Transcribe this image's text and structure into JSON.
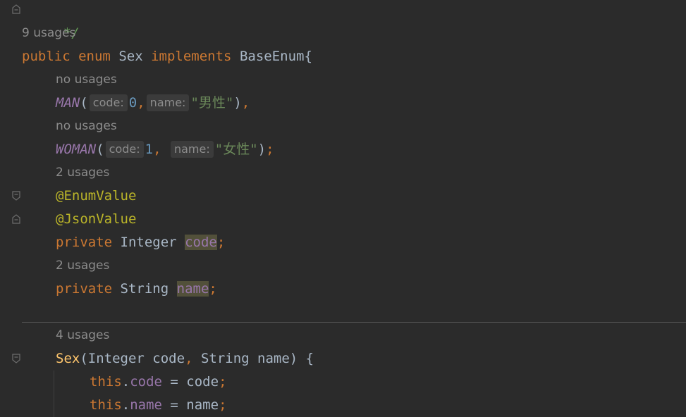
{
  "code": {
    "comment_end": "*/",
    "usages": {
      "enum_decl": "9 usages",
      "man": "no usages",
      "woman": "no usages",
      "code_field": "2 usages",
      "name_field": "2 usages",
      "constructor": "4 usages"
    },
    "enum_decl": {
      "kw_public": "public",
      "kw_enum": "enum",
      "name": "Sex",
      "kw_implements": "implements",
      "iface": "BaseEnum",
      "brace": "{"
    },
    "man": {
      "name": "MAN",
      "open": "(",
      "hint_code": "code:",
      "code_val": "0",
      "comma": ",",
      "hint_name": "name:",
      "name_val": "\"男性\"",
      "close": ")",
      "end": ","
    },
    "woman": {
      "name": "WOMAN",
      "open": "(",
      "hint_code": "code:",
      "code_val": "1",
      "comma": ", ",
      "hint_name": "name:",
      "name_val": "\"女性\"",
      "close": ")",
      "end": ";"
    },
    "annotations": [
      "@EnumValue",
      "@JsonValue"
    ],
    "code_field": {
      "kw": "private",
      "type": "Integer",
      "name": "code",
      "end": ";"
    },
    "name_field": {
      "kw": "private",
      "type": "String",
      "name": "name",
      "end": ";"
    },
    "constructor": {
      "name": "Sex",
      "open": "(",
      "params": "Integer code",
      "comma": ", ",
      "params2": "String name",
      "close": ") {"
    },
    "assign_code": {
      "kw": "this",
      "dot": ".",
      "field": "code",
      "rest": " = code",
      "end": ";"
    },
    "assign_name": {
      "kw": "this",
      "dot": ".",
      "field": "name",
      "rest": " = name",
      "end": ";"
    }
  },
  "colors": {
    "background": "#2b2b2b",
    "keyword": "#cc7832",
    "enum_constant": "#9876aa",
    "number": "#6897bb",
    "string": "#6a8759",
    "annotation": "#bbb529",
    "method": "#ffc66d",
    "text": "#a9b7c6"
  }
}
